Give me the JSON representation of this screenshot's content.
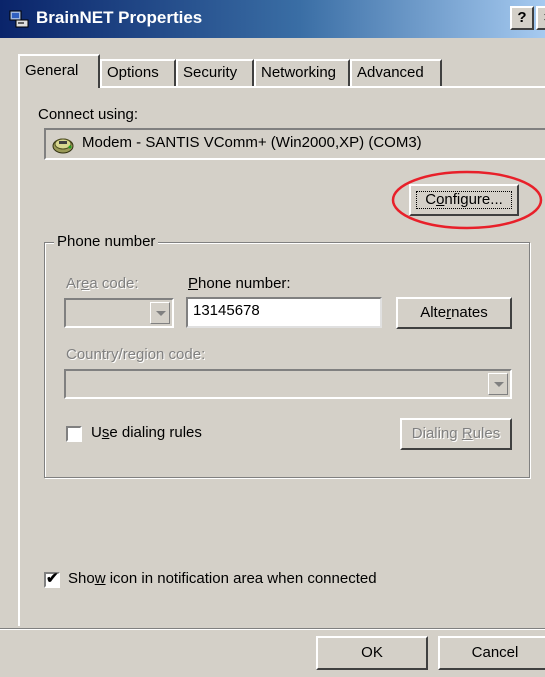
{
  "window": {
    "title": "BrainNET Properties",
    "help_button": "?",
    "close_button": "×"
  },
  "tabs": [
    {
      "label": "General",
      "active": true
    },
    {
      "label": "Options",
      "active": false
    },
    {
      "label": "Security",
      "active": false
    },
    {
      "label": "Networking",
      "active": false
    },
    {
      "label": "Advanced",
      "active": false
    }
  ],
  "connect": {
    "label": "Connect using:",
    "device": "Modem - SANTIS VComm+ (Win2000,XP) (COM3)",
    "configure_button": {
      "prefix": "C",
      "underline": "o",
      "suffix": "nfigure..."
    }
  },
  "phone_group": {
    "title": "Phone number",
    "area_code_label": {
      "prefix": "Ar",
      "underline": "e",
      "suffix": "a code:"
    },
    "area_code_value": "",
    "phone_number_label": {
      "prefix": "",
      "underline": "P",
      "suffix": "hone number:"
    },
    "phone_number_value": "13145678",
    "alternates_button": {
      "prefix": "Alte",
      "underline": "r",
      "suffix": "nates"
    },
    "country_label": "Country/region code:",
    "country_value": "",
    "dialing_rules_checkbox": {
      "prefix": "U",
      "underline": "s",
      "suffix": "e dialing rules",
      "checked": false
    },
    "dialing_rules_button": {
      "prefix": "Dialing ",
      "underline": "R",
      "suffix": "ules"
    }
  },
  "notification_checkbox": {
    "prefix": "Sho",
    "underline": "w",
    "suffix": " icon in notification area when connected",
    "checked": true
  },
  "footer": {
    "ok_button": "OK",
    "cancel_button": "Cancel"
  },
  "annotation": {
    "color": "#e8202a"
  },
  "colors": {
    "title_bar_start": "#0a246a",
    "title_bar_end": "#a6caf0",
    "face": "#d4d0c8"
  }
}
